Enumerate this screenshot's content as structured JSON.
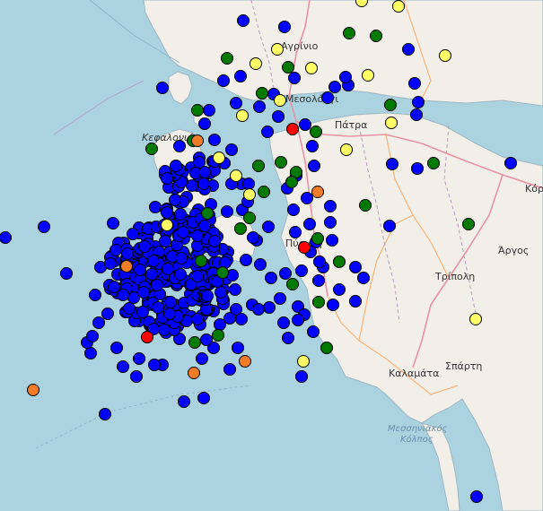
{
  "map": {
    "labels": {
      "agrinio": "Αγρίνιο",
      "mesolongi": "Μεσολόγγι",
      "patra": "Πάτρα",
      "kefalonia": "Κεφαλονιά",
      "pyrgos": "Πύργος",
      "tripoli": "Τρίπολη",
      "argos": "Άργος",
      "kalamata": "Καλαμάτα",
      "sparti": "Σπάρτη",
      "korinthos": "Κόριν",
      "gulf_line1": "Μεσσηνιακός",
      "gulf_line2": "Κόλπος"
    },
    "colors": {
      "sea": "#aad3df",
      "land": "#f2efe9",
      "coast": "#9fb6c3",
      "motorway": "#e892a2",
      "primary": "#f9b27a",
      "border": "#b99abf",
      "marker_stroke": "#000000",
      "magnitude_small": "#0000ff",
      "magnitude_medium": "#007a00",
      "magnitude_large": "#ffff66",
      "magnitude_larger": "#f07c28",
      "magnitude_largest": "#ff0000"
    },
    "marker_legend_order": [
      "blue",
      "green",
      "yellow",
      "orange",
      "red"
    ]
  }
}
